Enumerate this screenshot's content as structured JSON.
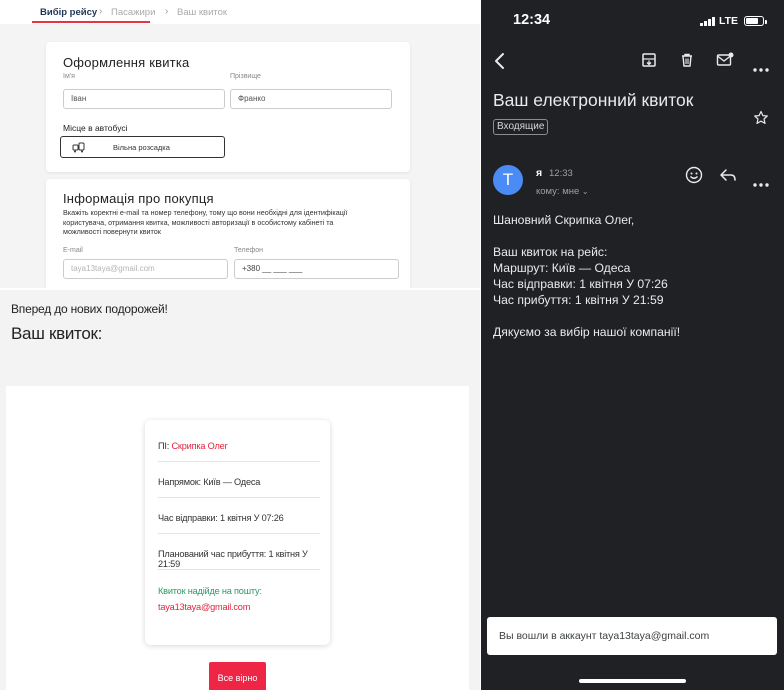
{
  "form": {
    "steps": [
      "Вибір рейсу",
      "Пасажири",
      "Ваш квиток"
    ],
    "ticket_card": {
      "title": "Оформлення квитка",
      "first_name_label": "Ім'я",
      "first_name_value": "Іван",
      "last_name_label": "Прізвище",
      "last_name_value": "Франко",
      "seat_label": "Місце в автобусі",
      "seat_button": "Вільна розсадка"
    },
    "buyer_card": {
      "title": "Інформація про покупця",
      "description_lines": [
        "Вкажіть коректні e-mail та номер телефону, тому що вони необхідні для ідентифікації",
        "користувача, отримання квитка, можливості авторизації в особистому кабінеті та",
        "можливості повернути квиток"
      ],
      "email_label": "E-mail",
      "email_placeholder": "taya13taya@gmail.com",
      "phone_label": "Телефон",
      "phone_placeholder": "+380 __ ___ ___"
    }
  },
  "result": {
    "greeting": "Вперед до нових подорожей!",
    "title": "Ваш квиток:",
    "ticket": {
      "name_label": "ПІ: ",
      "name_value": "Скрипка Олег",
      "route": "Напрямок: Київ — Одеса",
      "departure": "Час відправки: 1 квітня У 07:26",
      "arrival": "Планований час прибуття: 1 квітня У 21:59",
      "email_note": "Квиток надійде на пошту:",
      "email": "taya13taya@gmail.com"
    },
    "all_button": "Все вірно"
  },
  "mail": {
    "status_time": "12:34",
    "network": "LTE",
    "subject": "Ваш електронний квиток",
    "label": "Входящие",
    "avatar_letter": "Т",
    "sender": "я",
    "time": "12:33",
    "recipient": "кому: мне",
    "body_lines": [
      "Шановний Скрипка Олег,",
      "",
      "Ваш квиток на рейс:",
      "Маршрут: Київ — Одеса",
      "Час відправки: 1 квітня У 07:26",
      "Час прибуття: 1 квітня У 21:59",
      "",
      "Дякуємо за вибір нашої компанії!"
    ],
    "toast": "Вы вошли в аккаунт taya13taya@gmail.com"
  },
  "colors": {
    "accent_red": "#e0253d",
    "accent_green": "#2a9a63",
    "avatar_blue": "#4a8bf5",
    "dark_bg": "#202124"
  }
}
